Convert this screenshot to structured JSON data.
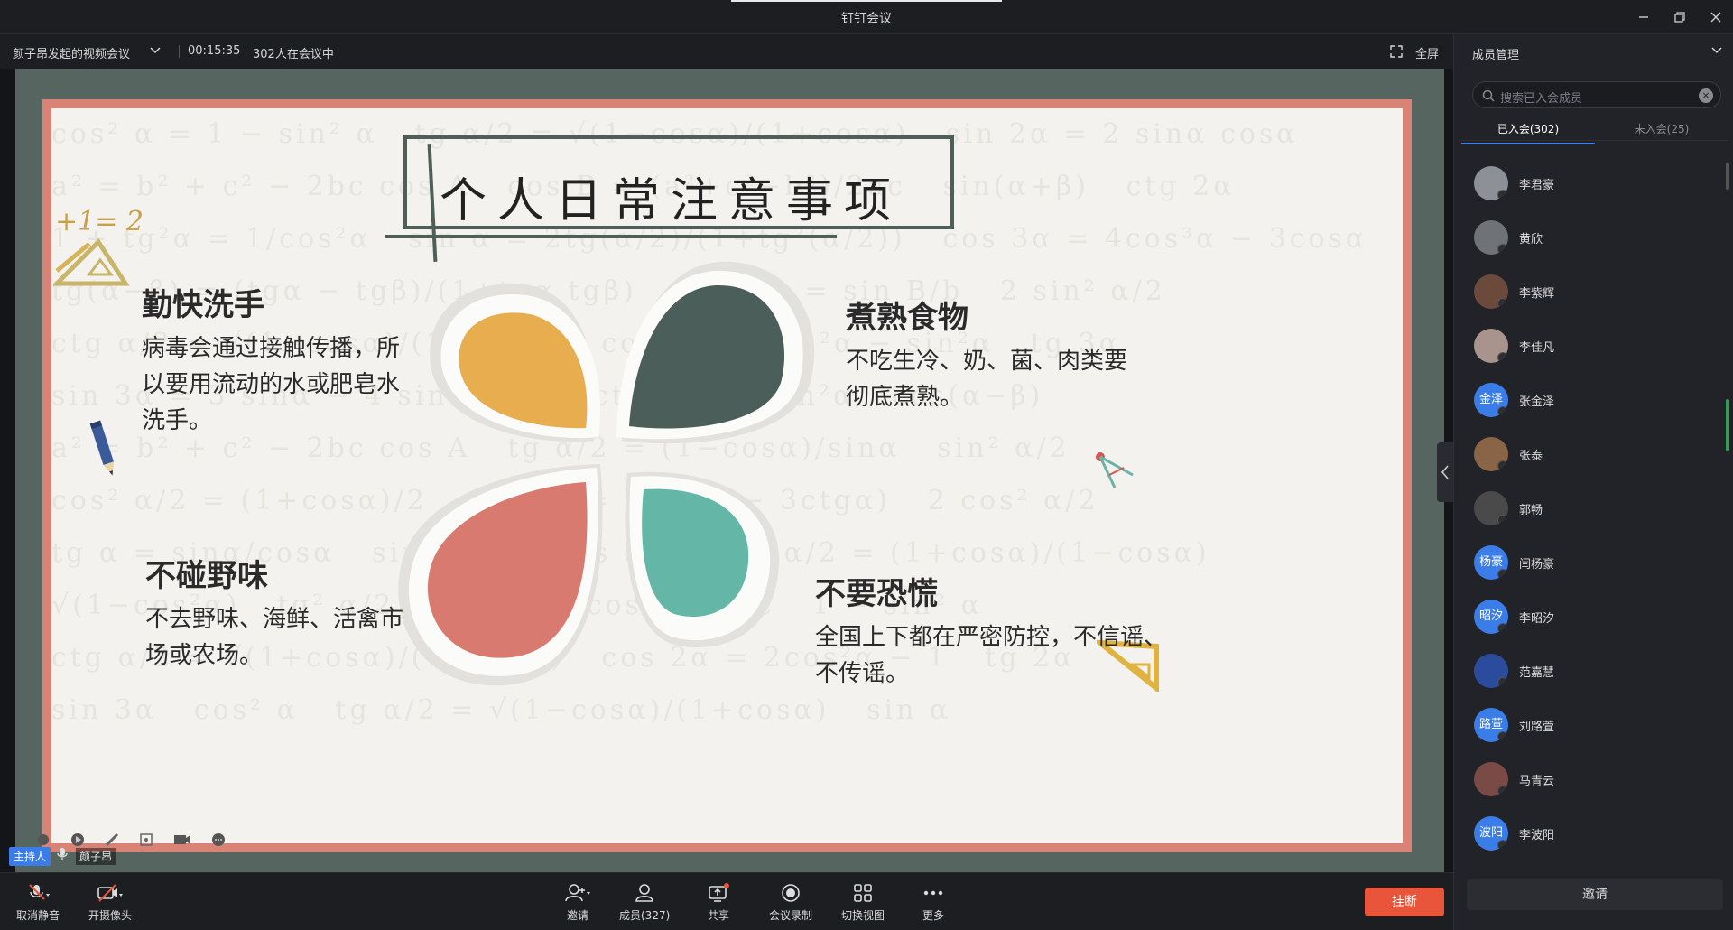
{
  "window": {
    "title": "钉钉会议"
  },
  "meeting": {
    "title": "颜子昂发起的视频会议",
    "elapsed": "00:15:35",
    "participants_status": "302人在会议中",
    "fullscreen_label": "全屏"
  },
  "slide": {
    "title": "个人日常注意事项",
    "equation": "+1= 2",
    "sections": [
      {
        "heading": "勤快洗手",
        "lines": [
          "病毒会通过接触传播，所",
          "以要用流动的水或肥皂水",
          "洗手。"
        ]
      },
      {
        "heading": "不碰野味",
        "lines": [
          "不去野味、海鲜、活禽市",
          "场或农场。"
        ]
      },
      {
        "heading": "煮熟食物",
        "lines": [
          "不吃生冷、奶、菌、肉类要",
          "彻底煮熟。"
        ]
      },
      {
        "heading": "不要恐慌",
        "lines": [
          "全国上下都在严密防控，不信谣、",
          "不传谣。"
        ]
      }
    ],
    "petal_colors": {
      "top_left": "#e8ad4f",
      "top_right": "#4b5e59",
      "bottom_left": "#d97a70",
      "bottom_right": "#64b7a6"
    }
  },
  "host": {
    "tag": "主持人",
    "name": "颜子昂"
  },
  "toolbar": {
    "mute_label": "取消静音",
    "camera_label": "开摄像头",
    "invite_label": "邀请",
    "members_label": "成员(327)",
    "share_label": "共享",
    "record_label": "会议录制",
    "view_label": "切换视图",
    "more_label": "更多",
    "hangup_label": "挂断"
  },
  "panel": {
    "title": "成员管理",
    "search_placeholder": "搜索已入会成员",
    "tab_joined": "已入会(302)",
    "tab_not_joined": "未入会(25)",
    "invite_label": "邀请",
    "members": [
      {
        "name": "李君豪",
        "avatar_text": "",
        "color": "#8d9096"
      },
      {
        "name": "黄欣",
        "avatar_text": "",
        "color": "#6f7276"
      },
      {
        "name": "李紫辉",
        "avatar_text": "",
        "color": "#6b4a3c"
      },
      {
        "name": "李佳凡",
        "avatar_text": "",
        "color": "#a9948d"
      },
      {
        "name": "张金泽",
        "avatar_text": "金泽",
        "color": "#3b7de8"
      },
      {
        "name": "张泰",
        "avatar_text": "",
        "color": "#8a6446"
      },
      {
        "name": "郭畅",
        "avatar_text": "",
        "color": "#4a4a4a"
      },
      {
        "name": "闫杨豪",
        "avatar_text": "杨豪",
        "color": "#3b7de8"
      },
      {
        "name": "李昭汐",
        "avatar_text": "昭汐",
        "color": "#3b7de8"
      },
      {
        "name": "范嘉慧",
        "avatar_text": "",
        "color": "#2b4c9c"
      },
      {
        "name": "刘路萱",
        "avatar_text": "路萱",
        "color": "#3b7de8"
      },
      {
        "name": "马青云",
        "avatar_text": "",
        "color": "#7a4a46"
      },
      {
        "name": "李波阳",
        "avatar_text": "波阳",
        "color": "#3b7de8"
      }
    ]
  }
}
